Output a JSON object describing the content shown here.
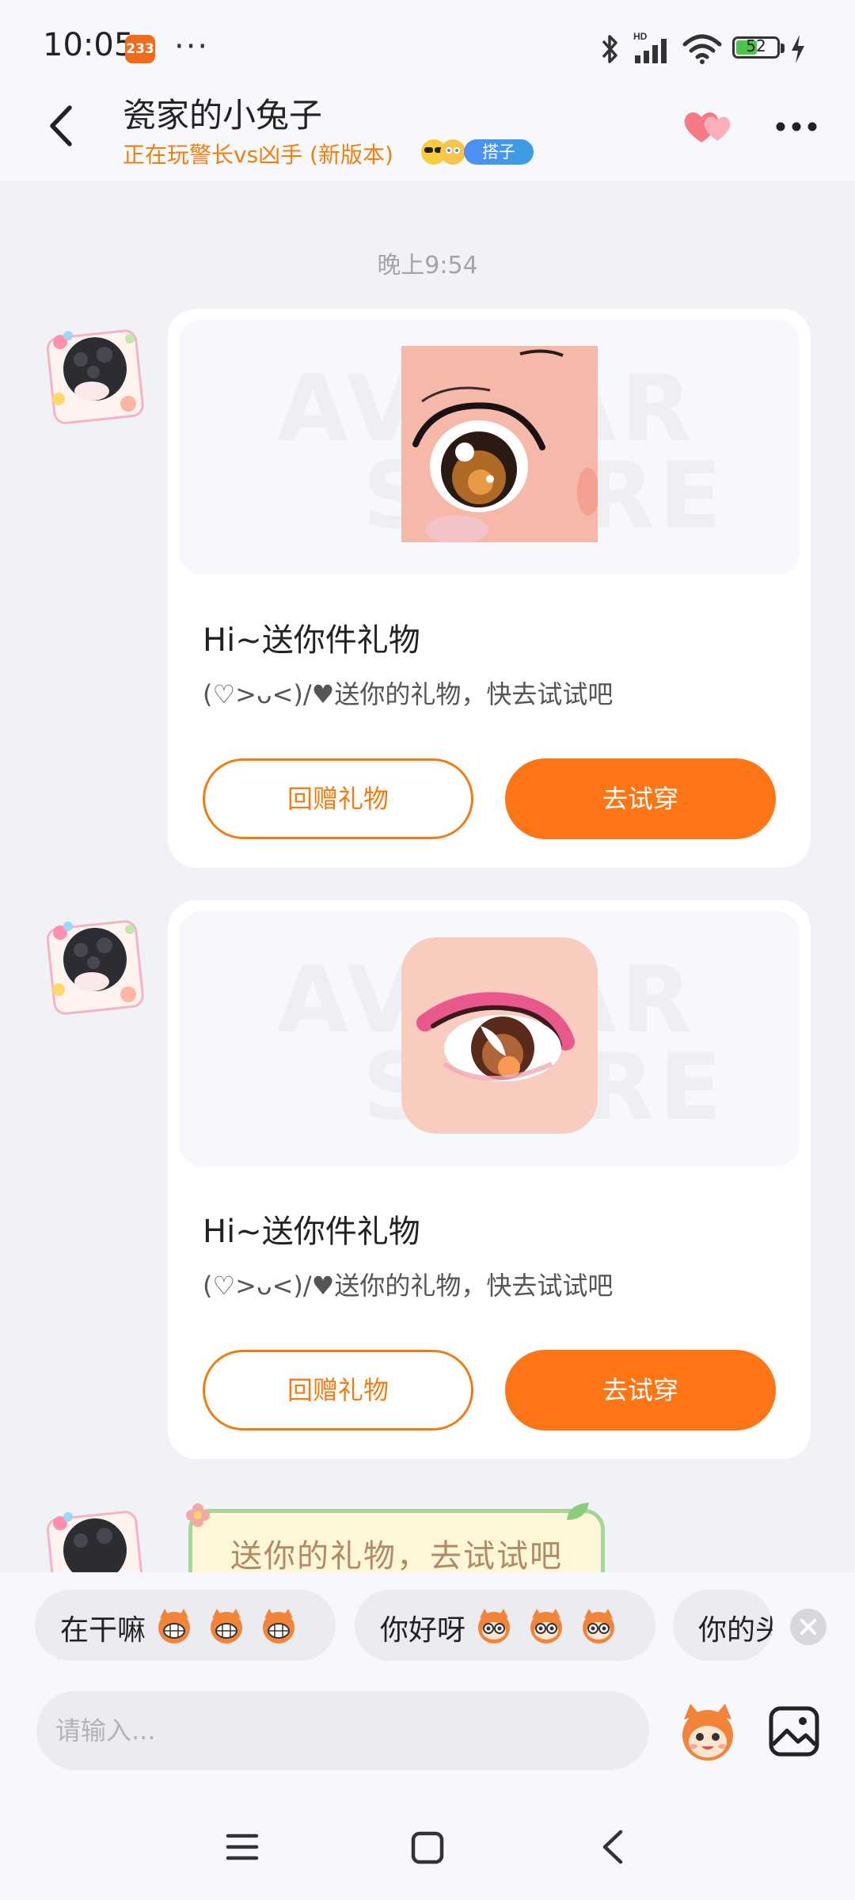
{
  "status_bar": {
    "time": "10:05",
    "notification_badge": "233",
    "more": "···",
    "battery_level": "52",
    "battery_fraction": 0.52,
    "icons": [
      "bluetooth-icon",
      "hd-signal-icon",
      "wifi-icon",
      "battery-icon",
      "charging-icon"
    ]
  },
  "header": {
    "title": "瓷家的小兔子",
    "subtitle": "正在玩警长vs凶手 (新版本)",
    "tag": "搭子",
    "icons": [
      "back-arrow-icon",
      "hearts-icon",
      "more-icon"
    ]
  },
  "messages": {
    "time_divider": "晚上9:54",
    "gifts": [
      {
        "title": "Hi~送你件礼物",
        "desc": "(♡>ᴗ<)/♥送你的礼物，快去试试吧",
        "return_label": "回赠礼物",
        "try_label": "去试穿",
        "watermark_1": "AVATAR",
        "watermark_2": "STORE",
        "thumbnail": "eye-makeup-thumbnail-1"
      },
      {
        "title": "Hi~送你件礼物",
        "desc": "(♡>ᴗ<)/♥送你的礼物，快去试试吧",
        "return_label": "回赠礼物",
        "try_label": "去试穿",
        "watermark_1": "AVATAR",
        "watermark_2": "STORE",
        "thumbnail": "eye-makeup-thumbnail-2"
      }
    ],
    "text_bubble": "送你的礼物，去试试吧"
  },
  "quick_replies": [
    {
      "text": "在干嘛",
      "emoji": "grinning-mascot-icon"
    },
    {
      "text": "你好呀",
      "emoji": "wide-eyed-mascot-icon"
    },
    {
      "text": "你的头像"
    }
  ],
  "input": {
    "placeholder": "请输入..."
  },
  "colors": {
    "accent": "#fd7514",
    "subtitle": "#f07f12",
    "background": "#f1f2f6",
    "tag": "#4f8ef7"
  }
}
